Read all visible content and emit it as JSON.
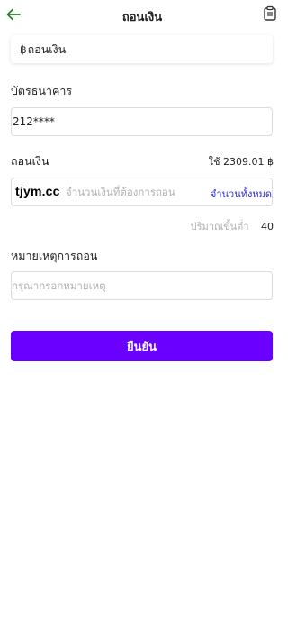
{
  "header": {
    "title": "ถอนเงิน",
    "back_icon": "arrow-left-icon",
    "record_icon": "clipboard-icon",
    "accent_color": "#2e7d32"
  },
  "method": {
    "icon": "฿",
    "label": "ถอนเงิน"
  },
  "bank_card": {
    "label": "บัตรธนาคาร",
    "value": "212****"
  },
  "withdraw": {
    "label": "ถอนเงิน",
    "balance_text": "ใช้ 2309.01 ฿",
    "watermark": "tjym.cc",
    "placeholder": "จำนวนเงินที่ต้องการถอน",
    "all_label": "จำนวนทั้งหมด",
    "min_label": "ปริมาณขั้นต่ำ",
    "min_value": "40"
  },
  "note": {
    "label": "หมายเหตุการถอน",
    "placeholder": "กรุณากรอกหมายเหตุ"
  },
  "confirm": {
    "label": "ยืนยัน",
    "color": "#6a00ff"
  }
}
